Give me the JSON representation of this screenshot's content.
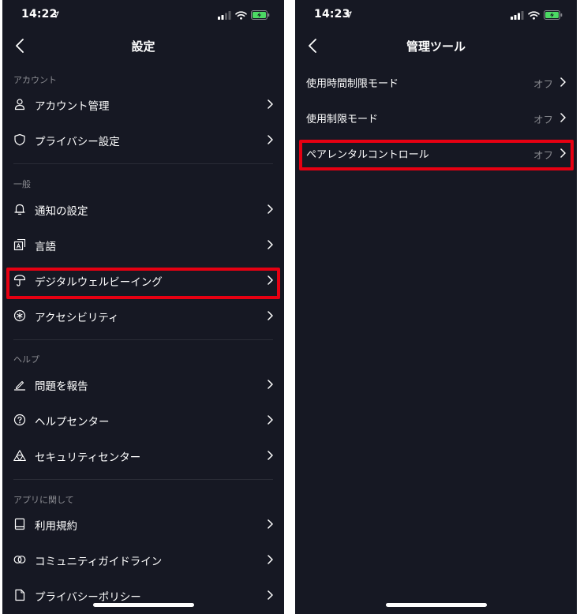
{
  "colors": {
    "background": "#161823",
    "text": "#ffffff",
    "muted": "#8a8b91",
    "highlight": "#e60012"
  },
  "left": {
    "status": {
      "time": "14:22"
    },
    "nav": {
      "title": "設定"
    },
    "sections": {
      "account": {
        "header": "アカウント",
        "items": [
          {
            "label": "アカウント管理",
            "icon": "person-icon"
          },
          {
            "label": "プライバシー設定",
            "icon": "shield-icon"
          }
        ]
      },
      "general": {
        "header": "一般",
        "items": [
          {
            "label": "通知の設定",
            "icon": "bell-icon"
          },
          {
            "label": "言語",
            "icon": "language-icon"
          },
          {
            "label": "デジタルウェルビーイング",
            "icon": "umbrella-icon"
          },
          {
            "label": "アクセシビリティ",
            "icon": "accessibility-icon"
          }
        ]
      },
      "help": {
        "header": "ヘルプ",
        "items": [
          {
            "label": "問題を報告",
            "icon": "pencil-icon"
          },
          {
            "label": "ヘルプセンター",
            "icon": "question-icon"
          },
          {
            "label": "セキュリティセンター",
            "icon": "security-icon"
          }
        ]
      },
      "about": {
        "header": "アプリに関して",
        "items": [
          {
            "label": "利用規約",
            "icon": "book-icon"
          },
          {
            "label": "コミュニティガイドライン",
            "icon": "rings-icon"
          },
          {
            "label": "プライバシーポリシー",
            "icon": "document-icon"
          }
        ]
      }
    }
  },
  "right": {
    "status": {
      "time": "14:23"
    },
    "nav": {
      "title": "管理ツール"
    },
    "items": [
      {
        "label": "使用時間制限モード",
        "value": "オフ"
      },
      {
        "label": "使用制限モード",
        "value": "オフ"
      },
      {
        "label": "ペアレンタルコントロール",
        "value": "オフ"
      }
    ]
  }
}
